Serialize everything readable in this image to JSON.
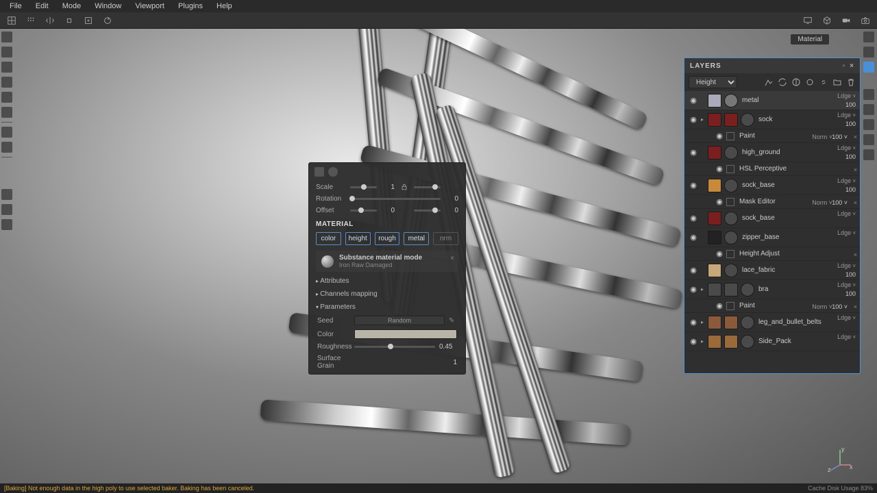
{
  "menu": {
    "items": [
      "File",
      "Edit",
      "Mode",
      "Window",
      "Viewport",
      "Plugins",
      "Help"
    ]
  },
  "material_chip": "Material",
  "fp": {
    "scale": {
      "label": "Scale",
      "value": "1",
      "value2": ""
    },
    "rotation": {
      "label": "Rotation",
      "value": "0"
    },
    "offset": {
      "label": "Offset",
      "value": "0",
      "value2": "0"
    },
    "section": "MATERIAL",
    "channels": {
      "color": "color",
      "height": "height",
      "rough": "rough",
      "metal": "metal",
      "nrm": "nrm"
    },
    "matmode": {
      "title": "Substance material mode",
      "sub": "Iron Raw Damaged"
    },
    "attributes": "Attributes",
    "chmap": "Channels mapping",
    "params": "Parameters",
    "seed": {
      "label": "Seed",
      "button": "Random"
    },
    "color_p": {
      "label": "Color"
    },
    "rough_p": {
      "label": "Roughness",
      "value": "0.45"
    },
    "surface_grain": {
      "label": "Surface Grain",
      "value": "1"
    }
  },
  "layers": {
    "title": "LAYERS",
    "channel": "Height",
    "items": [
      {
        "name": "metal",
        "blend": "Ldge",
        "opac": "100",
        "t1": "#aab",
        "t2": "#777",
        "sel": true
      },
      {
        "name": "sock",
        "blend": "Ldge",
        "opac": "100",
        "folder": true,
        "t1": "#7a1f1f",
        "t2": "#4a4a4a",
        "sub": {
          "name": "Paint",
          "norm": "Norm",
          "op": "100"
        }
      },
      {
        "name": "high_ground",
        "blend": "Ldge",
        "opac": "100",
        "t1": "#7a1f1f",
        "t2": "#4a4a4a",
        "sub": {
          "name": "HSL Perceptive"
        }
      },
      {
        "name": "sock_base",
        "blend": "Ldge",
        "opac": "100",
        "t1": "#c78a3a",
        "t2": "#4a4a4a",
        "sub": {
          "name": "Mask Editor",
          "norm": "Norm",
          "op": "100"
        }
      },
      {
        "name": "sock_base",
        "blend": "Ldge",
        "opac": "",
        "t1": "#7a1f1f",
        "t2": "#4a4a4a"
      },
      {
        "name": "zipper_base",
        "blend": "Ldge",
        "opac": "",
        "t1": "#222",
        "t2": "#4a4a4a",
        "sub": {
          "name": "Height Adjust"
        }
      },
      {
        "name": "lace_fabric",
        "blend": "Ldge",
        "opac": "100",
        "t1": "#c7a87a",
        "t2": "#4a4a4a"
      },
      {
        "name": "bra",
        "blend": "Ldge",
        "opac": "100",
        "folder": true,
        "t1": "#4a4a4a",
        "t2": "#4a4a4a",
        "sub": {
          "name": "Paint",
          "norm": "Norm",
          "op": "100"
        }
      },
      {
        "name": "leg_and_bullet_belts",
        "blend": "Ldge",
        "opac": "",
        "folder": true,
        "t1": "#8a5a3a",
        "t2": "#4a4a4a"
      },
      {
        "name": "Side_Pack",
        "blend": "Ldge",
        "opac": "",
        "folder": true,
        "t1": "#9a6a3a",
        "t2": "#4a4a4a"
      }
    ]
  },
  "status": {
    "error": "[Baking] Not enough data in the high poly to use selected baker. Baking has been canceled.",
    "cache": "Cache Disk Usage   83%"
  },
  "axis": {
    "x": "x",
    "y": "y",
    "z": "z"
  }
}
